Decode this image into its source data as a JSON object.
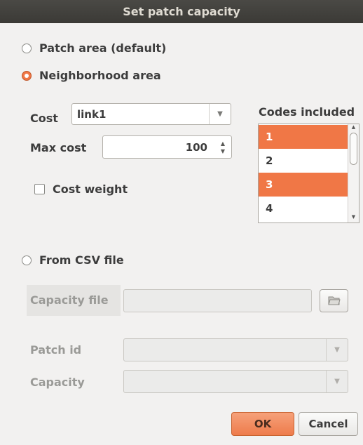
{
  "window": {
    "title": "Set patch capacity"
  },
  "options": {
    "patch_area": "Patch area (default)",
    "neighborhood_area": "Neighborhood area",
    "from_csv": "From CSV file"
  },
  "neighborhood": {
    "cost_label": "Cost",
    "cost_value": "link1",
    "max_cost_label": "Max cost",
    "max_cost_value": "100",
    "cost_weight_label": "Cost weight",
    "codes_label": "Codes included",
    "codes": [
      {
        "label": "1",
        "selected": true
      },
      {
        "label": "2",
        "selected": false
      },
      {
        "label": "3",
        "selected": true
      },
      {
        "label": "4",
        "selected": false
      }
    ]
  },
  "csv": {
    "capacity_file_label": "Capacity file",
    "capacity_file_value": "",
    "patch_id_label": "Patch id",
    "capacity_label": "Capacity"
  },
  "buttons": {
    "ok": "OK",
    "cancel": "Cancel"
  },
  "colors": {
    "accent": "#f07746",
    "titlebar": "#3c3b37"
  }
}
